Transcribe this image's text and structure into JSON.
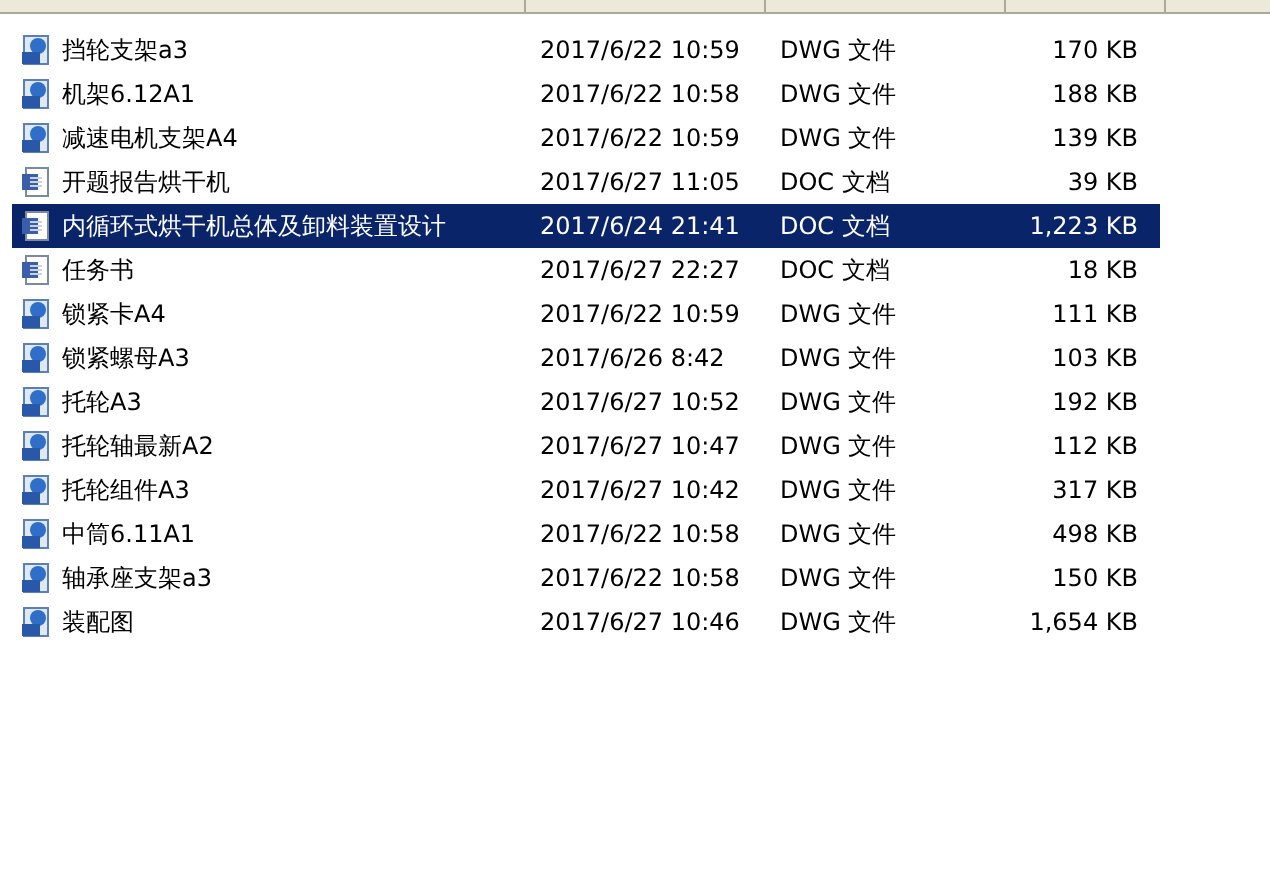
{
  "files": [
    {
      "kind": "dwg",
      "name": "挡轮支架a3",
      "modified": "2017/6/22 10:59",
      "type": "DWG 文件",
      "size": "170 KB",
      "selected": false
    },
    {
      "kind": "dwg",
      "name": "机架6.12A1",
      "modified": "2017/6/22 10:58",
      "type": "DWG 文件",
      "size": "188 KB",
      "selected": false
    },
    {
      "kind": "dwg",
      "name": "减速电机支架A4",
      "modified": "2017/6/22 10:59",
      "type": "DWG 文件",
      "size": "139 KB",
      "selected": false
    },
    {
      "kind": "doc",
      "name": "开题报告烘干机",
      "modified": "2017/6/27 11:05",
      "type": "DOC 文档",
      "size": "39 KB",
      "selected": false
    },
    {
      "kind": "doc",
      "name": "内循环式烘干机总体及卸料装置设计",
      "modified": "2017/6/24 21:41",
      "type": "DOC 文档",
      "size": "1,223 KB",
      "selected": true
    },
    {
      "kind": "doc",
      "name": "任务书",
      "modified": "2017/6/27 22:27",
      "type": "DOC 文档",
      "size": "18 KB",
      "selected": false
    },
    {
      "kind": "dwg",
      "name": "锁紧卡A4",
      "modified": "2017/6/22 10:59",
      "type": "DWG 文件",
      "size": "111 KB",
      "selected": false
    },
    {
      "kind": "dwg",
      "name": "锁紧螺母A3",
      "modified": "2017/6/26 8:42",
      "type": "DWG 文件",
      "size": "103 KB",
      "selected": false
    },
    {
      "kind": "dwg",
      "name": "托轮A3",
      "modified": "2017/6/27 10:52",
      "type": "DWG 文件",
      "size": "192 KB",
      "selected": false
    },
    {
      "kind": "dwg",
      "name": "托轮轴最新A2",
      "modified": "2017/6/27 10:47",
      "type": "DWG 文件",
      "size": "112 KB",
      "selected": false
    },
    {
      "kind": "dwg",
      "name": "托轮组件A3",
      "modified": "2017/6/27 10:42",
      "type": "DWG 文件",
      "size": "317 KB",
      "selected": false
    },
    {
      "kind": "dwg",
      "name": "中筒6.11A1",
      "modified": "2017/6/22 10:58",
      "type": "DWG 文件",
      "size": "498 KB",
      "selected": false
    },
    {
      "kind": "dwg",
      "name": "轴承座支架a3",
      "modified": "2017/6/22 10:58",
      "type": "DWG 文件",
      "size": "150 KB",
      "selected": false
    },
    {
      "kind": "dwg",
      "name": "装配图",
      "modified": "2017/6/27 10:46",
      "type": "DWG 文件",
      "size": "1,654 KB",
      "selected": false
    }
  ]
}
